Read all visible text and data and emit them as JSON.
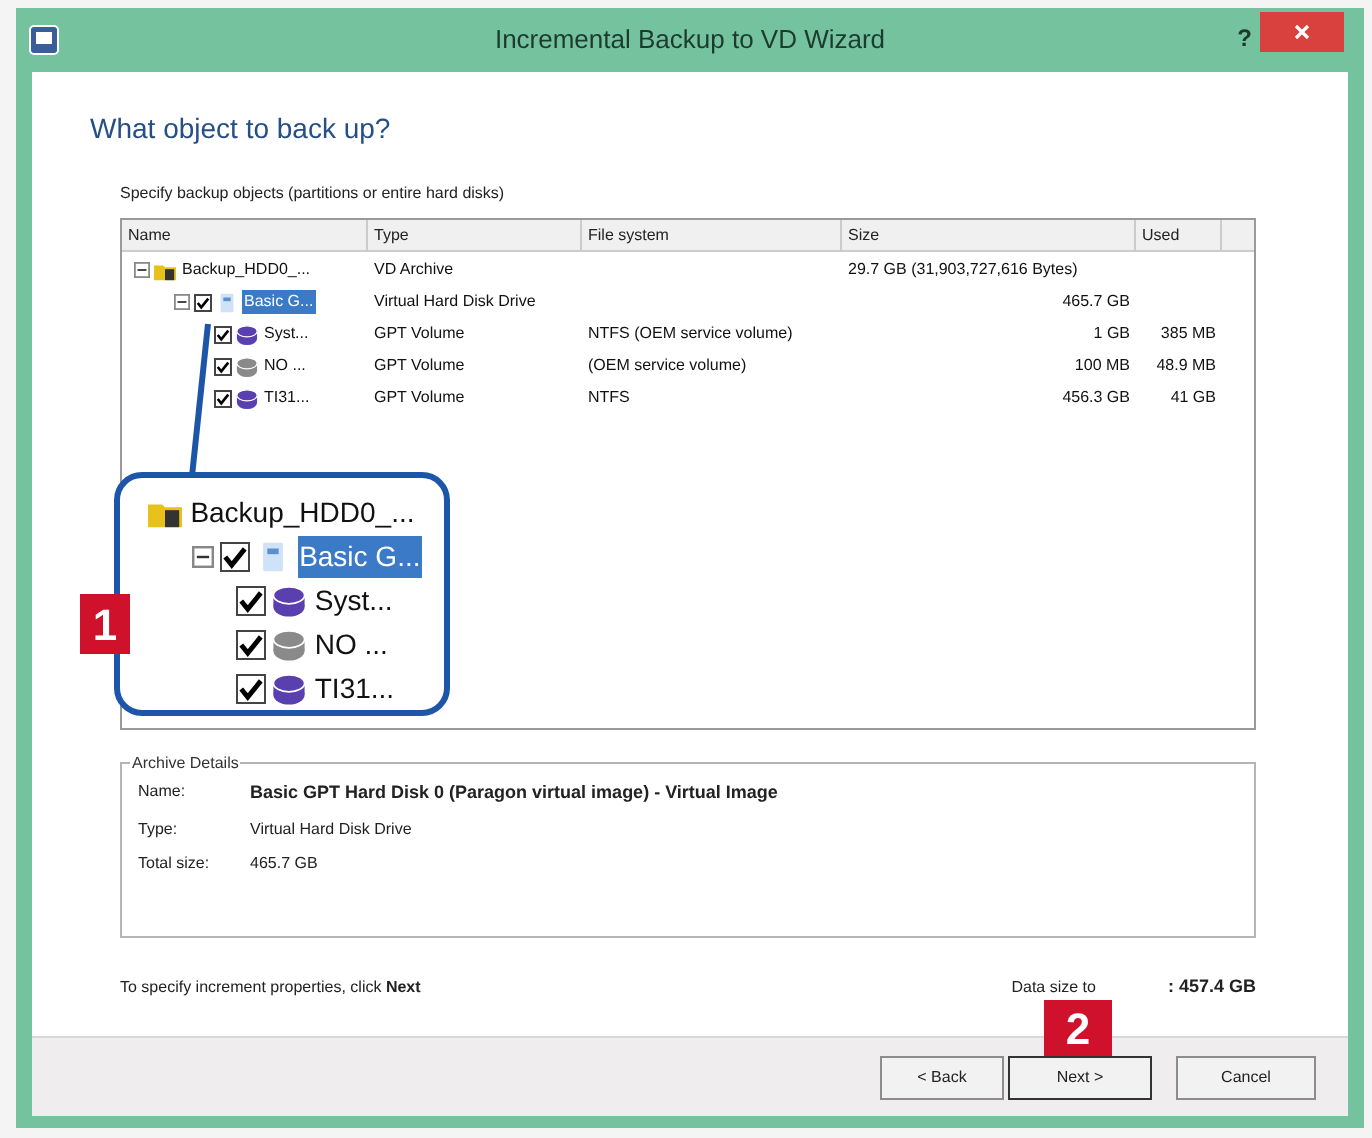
{
  "window": {
    "title": "Incremental Backup to VD Wizard",
    "help": "?"
  },
  "heading": "What object to back up?",
  "instruction": "Specify backup objects (partitions or entire hard disks)",
  "table": {
    "columns": [
      "Name",
      "Type",
      "File system",
      "Size",
      "Used"
    ],
    "rows": [
      {
        "kind": "archive",
        "name": "Backup_HDD0_...",
        "expanded": true,
        "selected": false,
        "type": "VD Archive",
        "size": "29.7 GB (31,903,727,616 Bytes)",
        "children": [
          {
            "kind": "drive",
            "name": "Basic G...",
            "expanded": true,
            "checked": true,
            "selected": true,
            "type": "Virtual Hard Disk Drive",
            "size": "465.7 GB",
            "children": [
              {
                "kind": "volume",
                "color": "#5a3fb0",
                "name": "Syst...",
                "checked": true,
                "selected": false,
                "type": "GPT Volume",
                "file_system": "NTFS (OEM service volume)",
                "size": "1 GB",
                "used": "385 MB"
              },
              {
                "kind": "volume",
                "color": "#8a8a8a",
                "name": "NO ...",
                "checked": true,
                "selected": false,
                "type": "GPT Volume",
                "file_system": "(OEM service volume)",
                "size": "100 MB",
                "used": "48.9 MB"
              },
              {
                "kind": "volume",
                "color": "#5a3fb0",
                "name": "TI31...",
                "checked": true,
                "selected": false,
                "type": "GPT Volume",
                "file_system": "NTFS",
                "size": "456.3 GB",
                "used": "41 GB"
              }
            ]
          }
        ]
      }
    ]
  },
  "magnifier": {
    "rows": [
      {
        "kind": "archive",
        "name": "Backup_HDD0_...",
        "selected": false,
        "children": [
          {
            "kind": "drive",
            "name": "Basic G...",
            "expanded": true,
            "checked": true,
            "selected": true,
            "children": [
              {
                "kind": "volume",
                "color": "#5a3fb0",
                "name": "Syst...",
                "checked": true,
                "selected": false
              },
              {
                "kind": "volume",
                "color": "#8a8a8a",
                "name": "NO ...",
                "checked": true,
                "selected": false
              },
              {
                "kind": "volume",
                "color": "#5a3fb0",
                "name": "TI31...",
                "checked": true,
                "selected": false
              }
            ]
          }
        ]
      }
    ]
  },
  "callouts": [
    {
      "number": "1"
    },
    {
      "number": "2"
    }
  ],
  "archive_details": {
    "title": "Archive Details",
    "fields": [
      {
        "label": "Name:",
        "value": "Basic GPT Hard Disk 0 (Paragon virtual image) - Virtual Image",
        "bold": true
      },
      {
        "label": "Type:",
        "value": "Virtual Hard Disk Drive",
        "bold": false
      },
      {
        "label": "Total size:",
        "value": "465.7 GB",
        "bold": false
      }
    ]
  },
  "hint": "To specify increment properties, click **Next**",
  "data_size": {
    "label": "Data size to",
    "value": ": 457.4 GB"
  },
  "buttons": [
    {
      "label": "< Back",
      "default": false
    },
    {
      "label": "Next >",
      "default": true
    },
    {
      "label": "Cancel",
      "default": false
    }
  ]
}
